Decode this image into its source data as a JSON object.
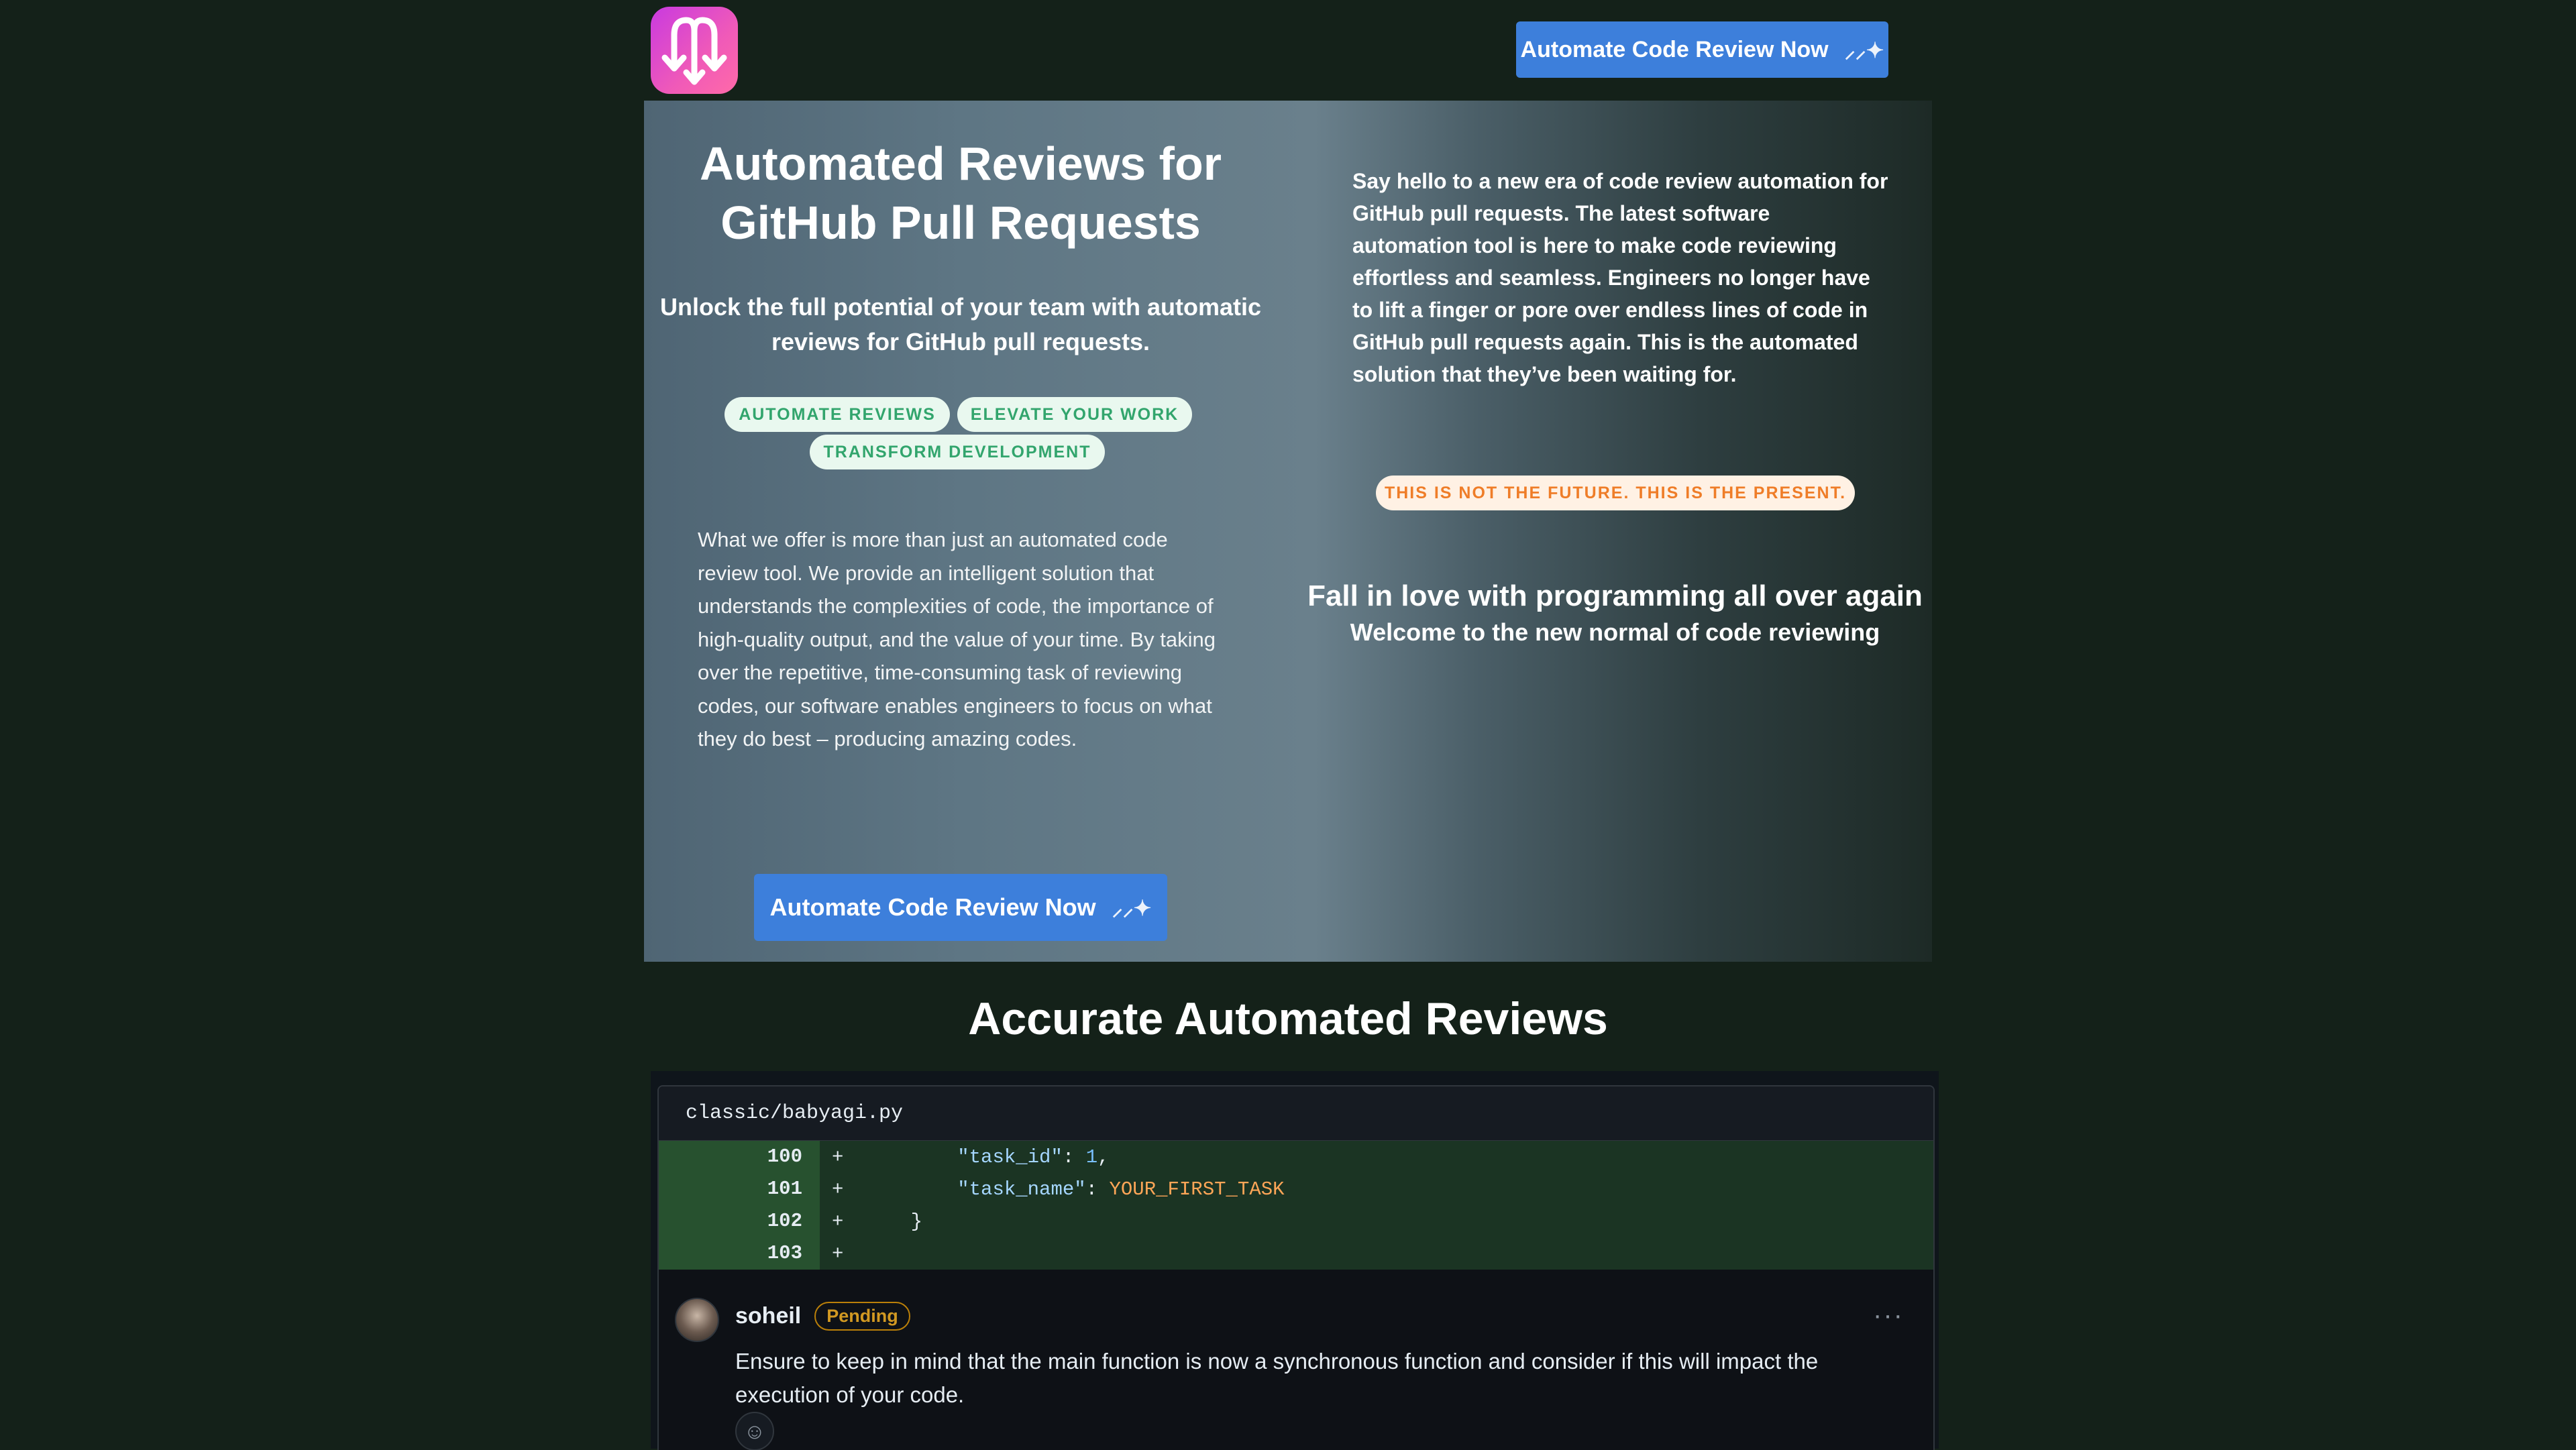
{
  "header": {
    "logo_icon": "download-arrows-logo-icon",
    "cta_label": "Automate Code Review Now",
    "cta_icon": "magic-wand-icon"
  },
  "hero": {
    "title": "Automated Reviews for GitHub Pull Requests",
    "subtitle": "Unlock the full potential of your team with automatic reviews for GitHub pull requests.",
    "tags": [
      "AUTOMATE REVIEWS",
      "ELEVATE YOUR WORK",
      "TRANSFORM DEVELOPMENT"
    ],
    "offer_text": "What we offer is more than just an automated code review tool. We provide an intelligent solution that understands the complexities of code, the importance of high-quality output, and the value of your time. By taking over the repetitive, time-consuming task of reviewing codes, our software enables engineers to focus on what they do best – producing amazing codes.",
    "cta_label": "Automate Code Review Now",
    "intro_text": "Say hello to a new era of code review automation for GitHub pull requests. The latest software automation tool is here to make code reviewing effortless and seamless. Engineers no longer have to lift a finger or pore over endless lines of code in GitHub pull requests again. This is the automated solution that they’ve been waiting for.",
    "present_badge": "THIS IS NOT THE FUTURE. THIS IS THE PRESENT.",
    "love_headline": "Fall in love with programming all over again",
    "welcome_line": "Welcome to the new normal of code reviewing"
  },
  "section": {
    "title": "Accurate Automated Reviews"
  },
  "review": {
    "file_path": "classic/babyagi.py",
    "lines": [
      {
        "num": "100",
        "sign": "+",
        "indent": "        ",
        "key": "\"task_id\"",
        "sep": ": ",
        "value": "1",
        "tail": ","
      },
      {
        "num": "101",
        "sign": "+",
        "indent": "        ",
        "key": "\"task_name\"",
        "sep": ": ",
        "value": "YOUR_FIRST_TASK",
        "tail": ""
      },
      {
        "num": "102",
        "sign": "+",
        "indent": "    ",
        "key": "}",
        "sep": "",
        "value": "",
        "tail": ""
      },
      {
        "num": "103",
        "sign": "+",
        "indent": "",
        "key": "",
        "sep": "",
        "value": "",
        "tail": ""
      }
    ],
    "comment": {
      "user": "soheil",
      "status": "Pending",
      "more_icon": "ellipsis-icon",
      "body": "Ensure to keep in mind that the main function is now a synchronous function and consider if this will impact the execution of your code.",
      "reaction_icon": "smiley-icon"
    }
  },
  "colors": {
    "page_bg": "#142119",
    "button": "#3d7fdb",
    "tag_text": "#32a56d",
    "present_text": "#ef7d28",
    "pending": "#d29922"
  }
}
